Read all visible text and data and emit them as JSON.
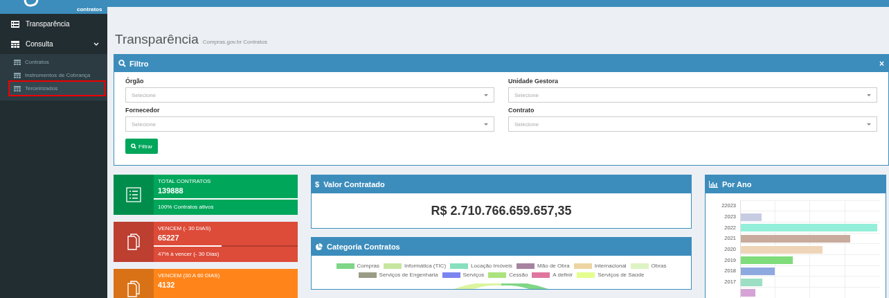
{
  "sidebar": {
    "logo_text": "contratos",
    "items": [
      {
        "label": "Transparência",
        "kind": "item"
      },
      {
        "label": "Consulta",
        "kind": "group",
        "expanded": true,
        "children": [
          {
            "label": "Contratos",
            "highlighted": false
          },
          {
            "label": "Instrumentos de Cobrança",
            "highlighted": false
          },
          {
            "label": "Terceirizados",
            "highlighted": true
          }
        ]
      }
    ]
  },
  "page": {
    "title": "Transparência",
    "subtitle": "Compras.gov.br Contratos"
  },
  "filter": {
    "title": "Filtro",
    "close": "×",
    "fields": [
      {
        "label": "Órgão",
        "placeholder": "Selecione"
      },
      {
        "label": "Unidade Gestora",
        "placeholder": "Selecione"
      },
      {
        "label": "Fornecedor",
        "placeholder": "Selecione"
      },
      {
        "label": "Contrato",
        "placeholder": "Selecione"
      }
    ],
    "button": "Filtrar"
  },
  "info_boxes": [
    {
      "kind": "list",
      "color": "#00a65a",
      "label": "TOTAL CONTRATOS",
      "number": "139888",
      "level": 1,
      "description": "100% Contratos ativos"
    },
    {
      "kind": "copy",
      "color": "#dd4b39",
      "label": "VENCEM (- 30 DIAS)",
      "number": "65227",
      "level": 0.47,
      "description": "47% à vencer (- 30 Dias)"
    },
    {
      "kind": "copy",
      "color": "#ff851b",
      "label": "VENCEM (30 A 60 DIAS)",
      "number": "4132"
    }
  ],
  "valor": {
    "title": "Valor Contratado",
    "symbol": "$",
    "amount": "R$ 2.710.766.659.657,35"
  },
  "categoria": {
    "title": "Categoria Contratos",
    "legend": [
      {
        "label": "Compras",
        "color": "#7ed687"
      },
      {
        "label": "Informática (TIC)",
        "color": "#c6e6a0"
      },
      {
        "label": "Locação Imóveis",
        "color": "#86e0bd"
      },
      {
        "label": "Mão de Obra",
        "color": "#a782a0"
      },
      {
        "label": "Internacional",
        "color": "#ecd5a3"
      },
      {
        "label": "Obras",
        "color": "#def3c2"
      },
      {
        "label": "Serviços de Engenharia",
        "color": "#9a9c86"
      },
      {
        "label": "Serviços",
        "color": "#7b85f0"
      },
      {
        "label": "Cessão",
        "color": "#abe27d"
      },
      {
        "label": "A definir",
        "color": "#e0769f"
      },
      {
        "label": "Serviços de Saúde",
        "color": "#e4fd8f"
      }
    ]
  },
  "por_ano": {
    "title": "Por Ano",
    "years": [
      "22023",
      "2023",
      "2022",
      "2021",
      "2020",
      "2019",
      "2018",
      "2017"
    ]
  }
}
